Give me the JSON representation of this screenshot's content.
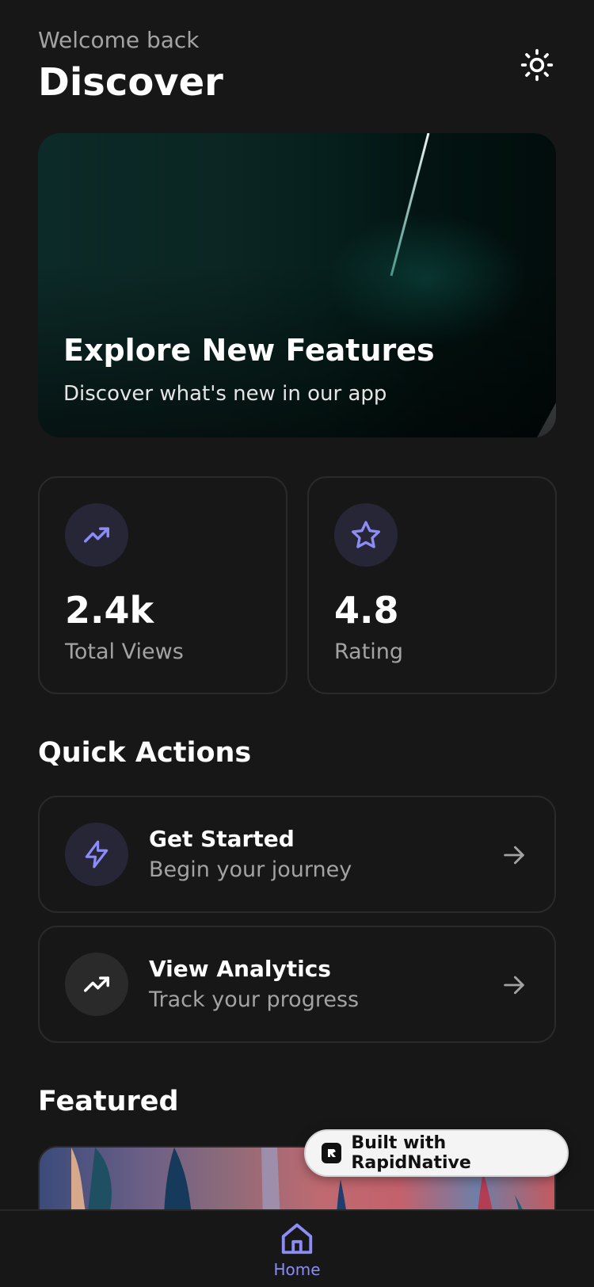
{
  "header": {
    "welcome": "Welcome back",
    "title": "Discover",
    "theme_icon": "sun-icon"
  },
  "hero": {
    "title": "Explore New Features",
    "subtitle": "Discover what's new in our app"
  },
  "stats": [
    {
      "value": "2.4k",
      "label": "Total Views",
      "icon": "trending-up-icon"
    },
    {
      "value": "4.8",
      "label": "Rating",
      "icon": "star-icon"
    }
  ],
  "quick_actions": {
    "title": "Quick Actions",
    "items": [
      {
        "title": "Get Started",
        "subtitle": "Begin your journey",
        "icon": "lightning-icon"
      },
      {
        "title": "View Analytics",
        "subtitle": "Track your progress",
        "icon": "trending-up-icon"
      }
    ]
  },
  "featured": {
    "title": "Featured"
  },
  "badge": {
    "label": "Built with RapidNative"
  },
  "tabbar": {
    "home_label": "Home"
  },
  "colors": {
    "background": "#171717",
    "accent": "#8b8cf5",
    "muted_text": "#a3a3a3",
    "card_border": "#2a2a2a"
  }
}
